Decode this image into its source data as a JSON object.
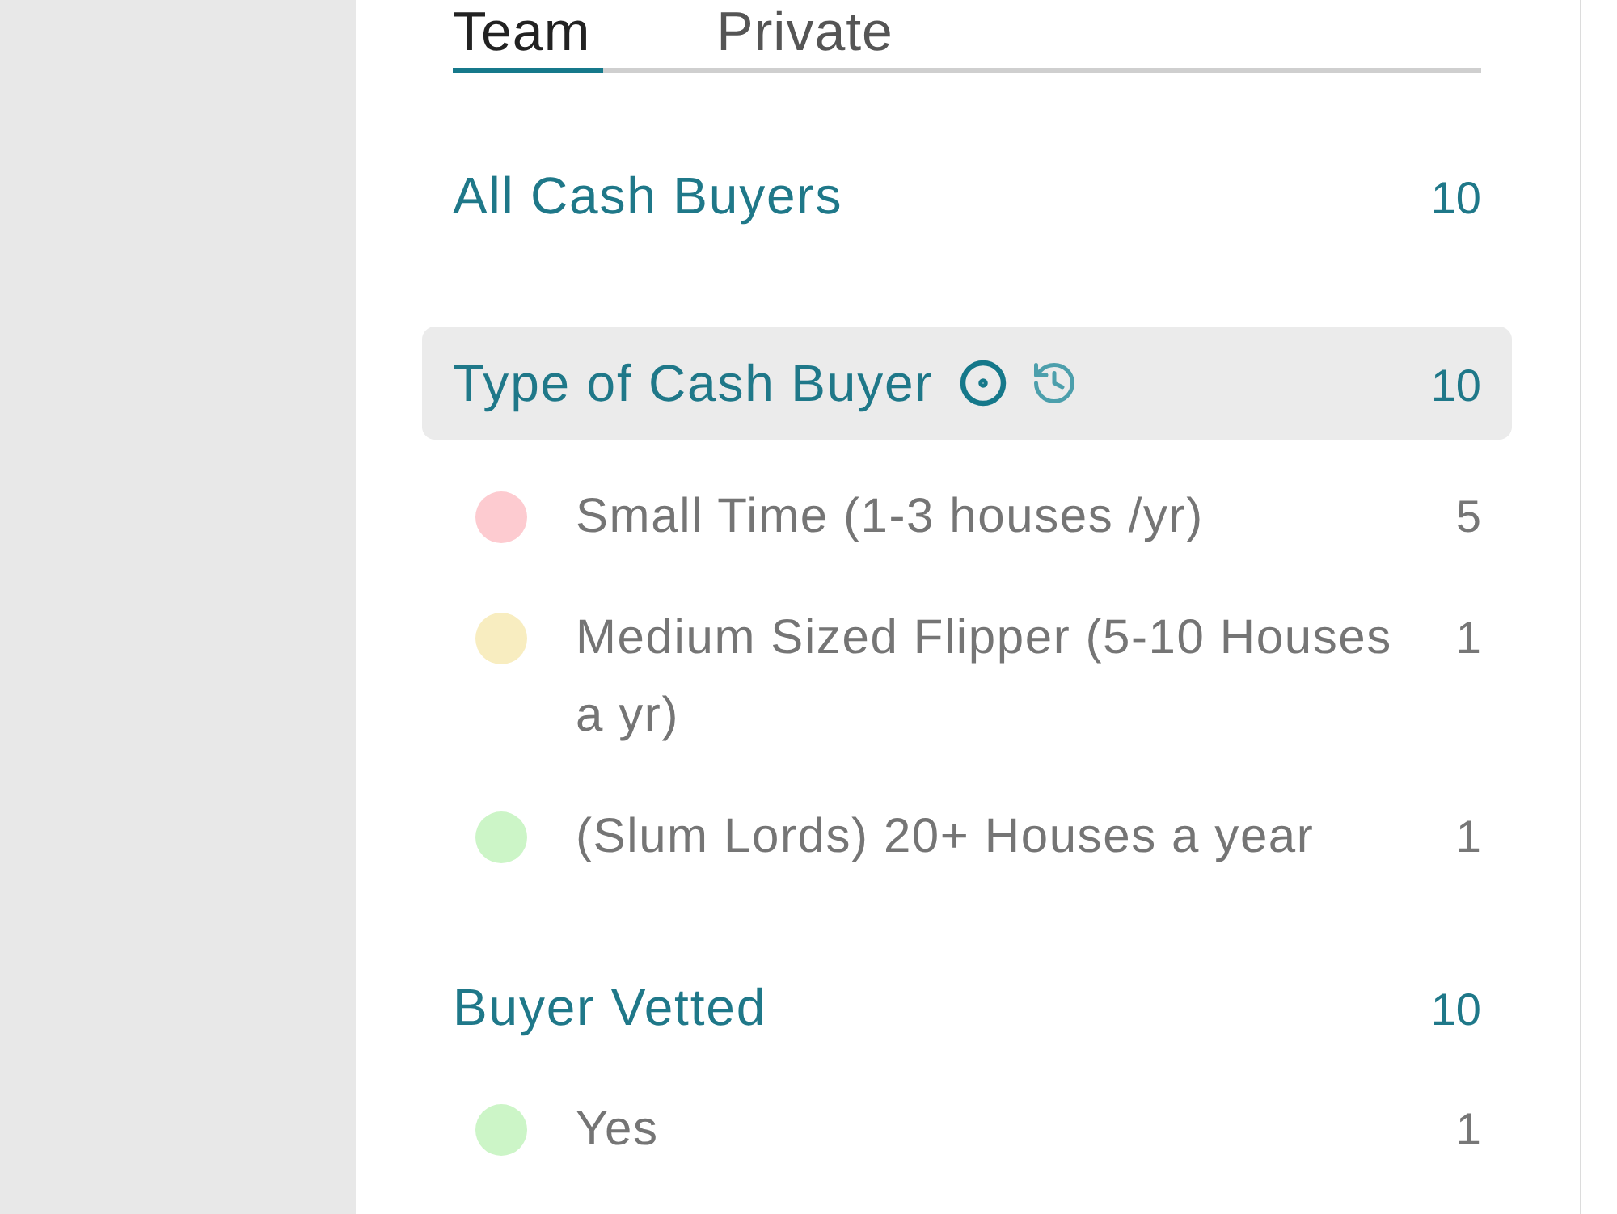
{
  "tabs": [
    {
      "label": "Team",
      "selected": true
    },
    {
      "label": "Private",
      "selected": false
    }
  ],
  "groups": [
    {
      "title": "All Cash Buyers",
      "count": "10",
      "highlighted": false
    },
    {
      "title": "Type of Cash Buyer",
      "count": "10",
      "highlighted": true,
      "options": [
        {
          "label": "Small Time (1-3 houses /yr)",
          "count": "5",
          "color": "#fdcbd0"
        },
        {
          "label": "Medium Sized Flipper (5-10 Houses a yr)",
          "count": "1",
          "color": "#f8edc0"
        },
        {
          "label": "(Slum Lords) 20+ Houses a year",
          "count": "1",
          "color": "#ccf5c7"
        }
      ]
    },
    {
      "title": "Buyer Vetted",
      "count": "10",
      "highlighted": false,
      "options": [
        {
          "label": "Yes",
          "count": "1",
          "color": "#ccf5c7"
        }
      ]
    }
  ]
}
